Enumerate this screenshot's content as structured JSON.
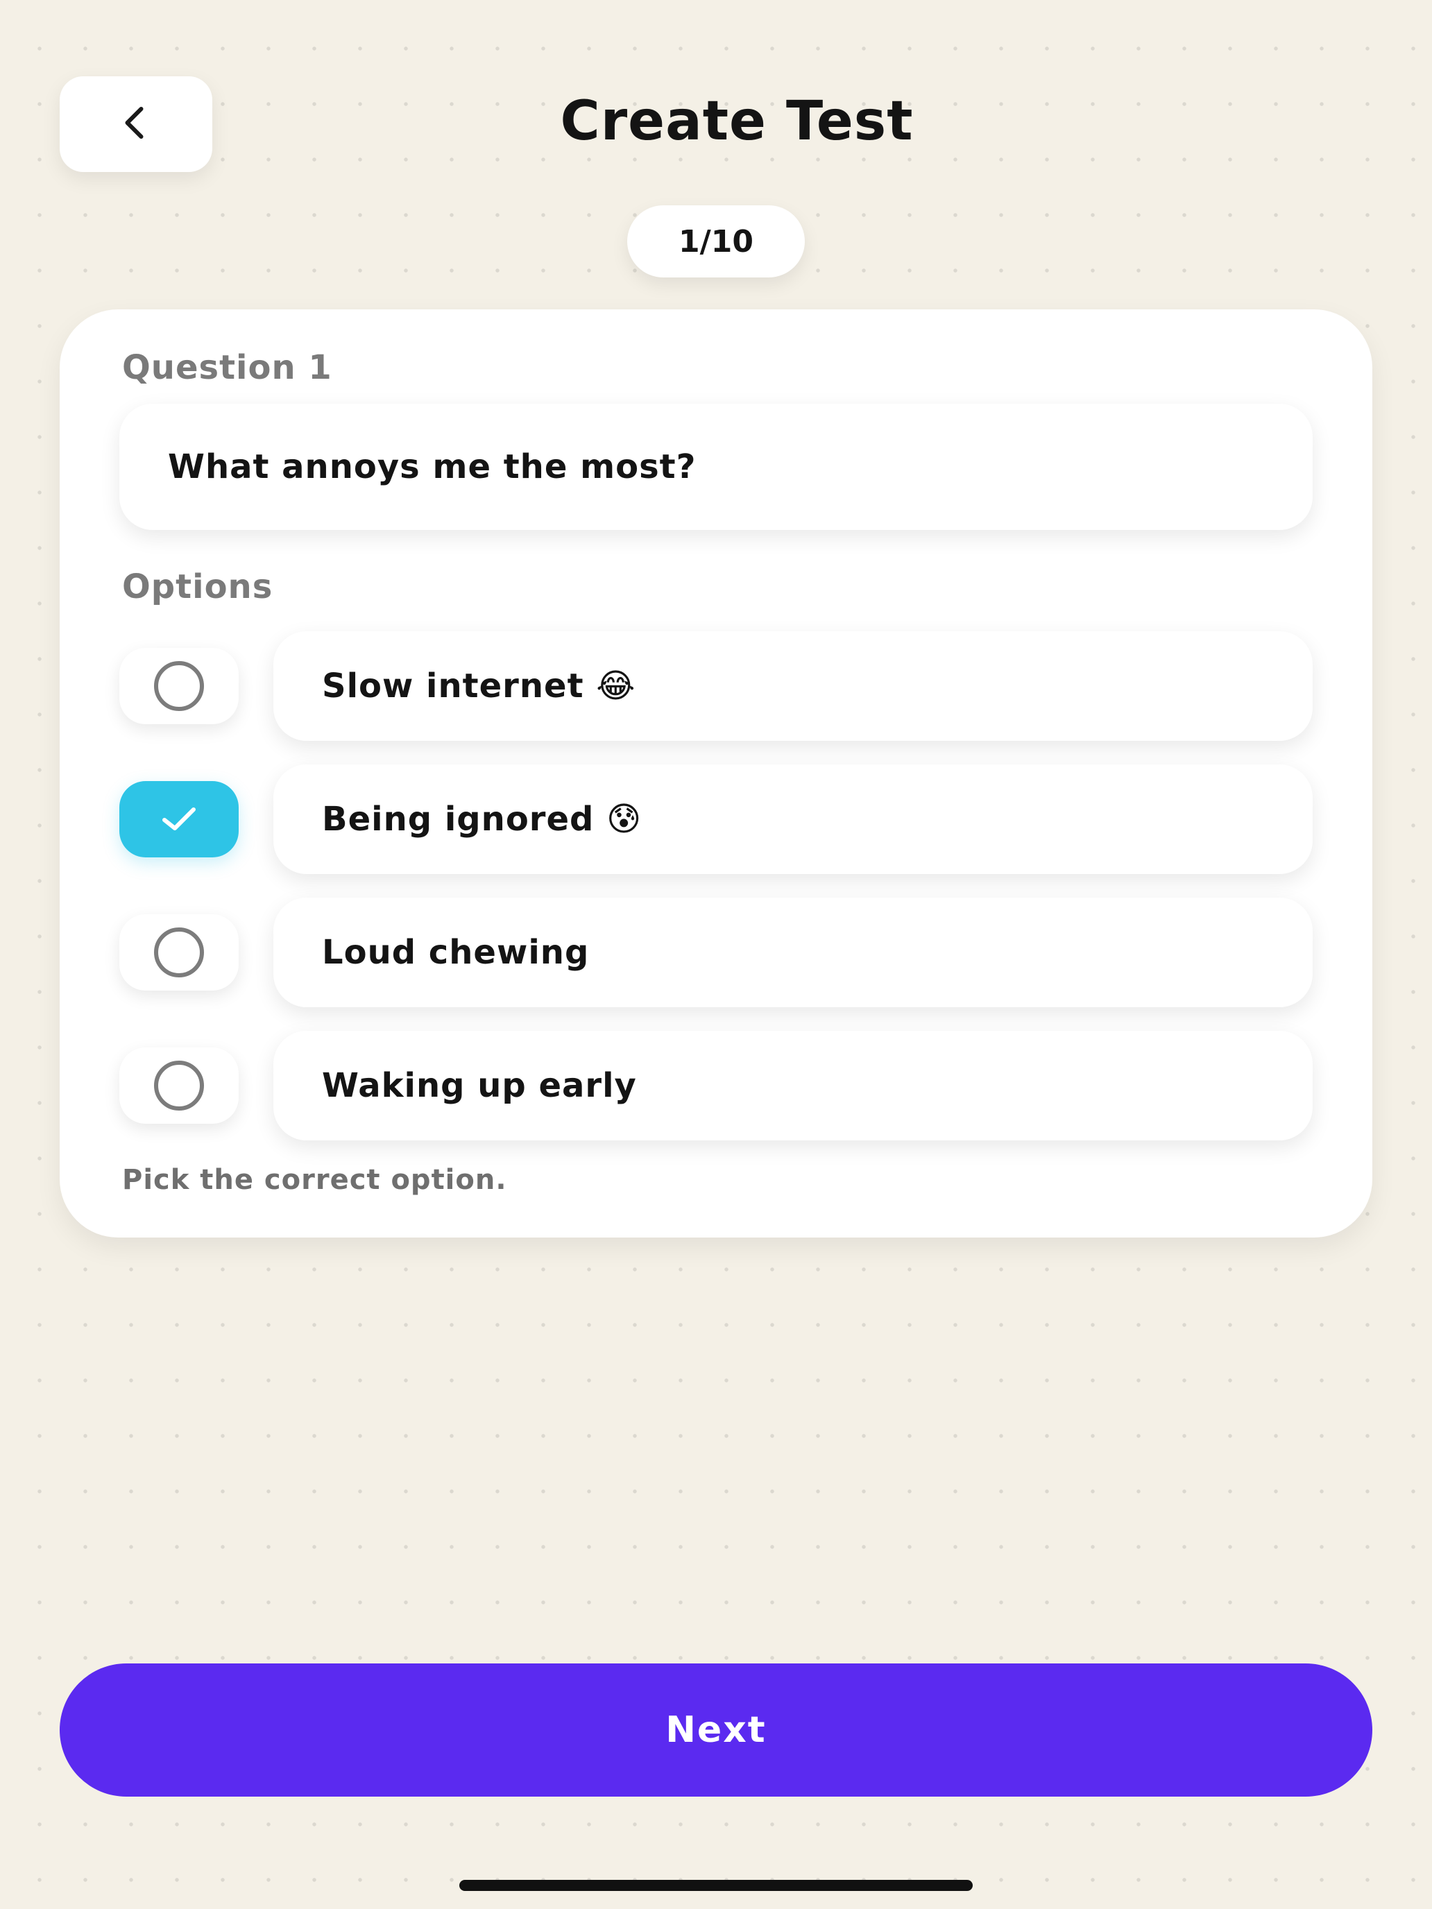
{
  "header": {
    "title": "Create Test",
    "back_icon": "chevron-left-icon"
  },
  "progress": {
    "label": "1/10",
    "current": 1,
    "total": 10
  },
  "question": {
    "label": "Question 1",
    "text": "What annoys me the most?"
  },
  "options": {
    "label": "Options",
    "items": [
      {
        "text": "Slow internet 😂",
        "selected": false
      },
      {
        "text": "Being ignored 😰",
        "selected": true
      },
      {
        "text": "Loud chewing",
        "selected": false
      },
      {
        "text": "Waking up early",
        "selected": false
      }
    ],
    "hint": "Pick the correct option."
  },
  "footer": {
    "next_label": "Next"
  },
  "colors": {
    "background": "#F4F0E6",
    "accent_check": "#2EC4E6",
    "primary_button": "#5B2AF0"
  }
}
